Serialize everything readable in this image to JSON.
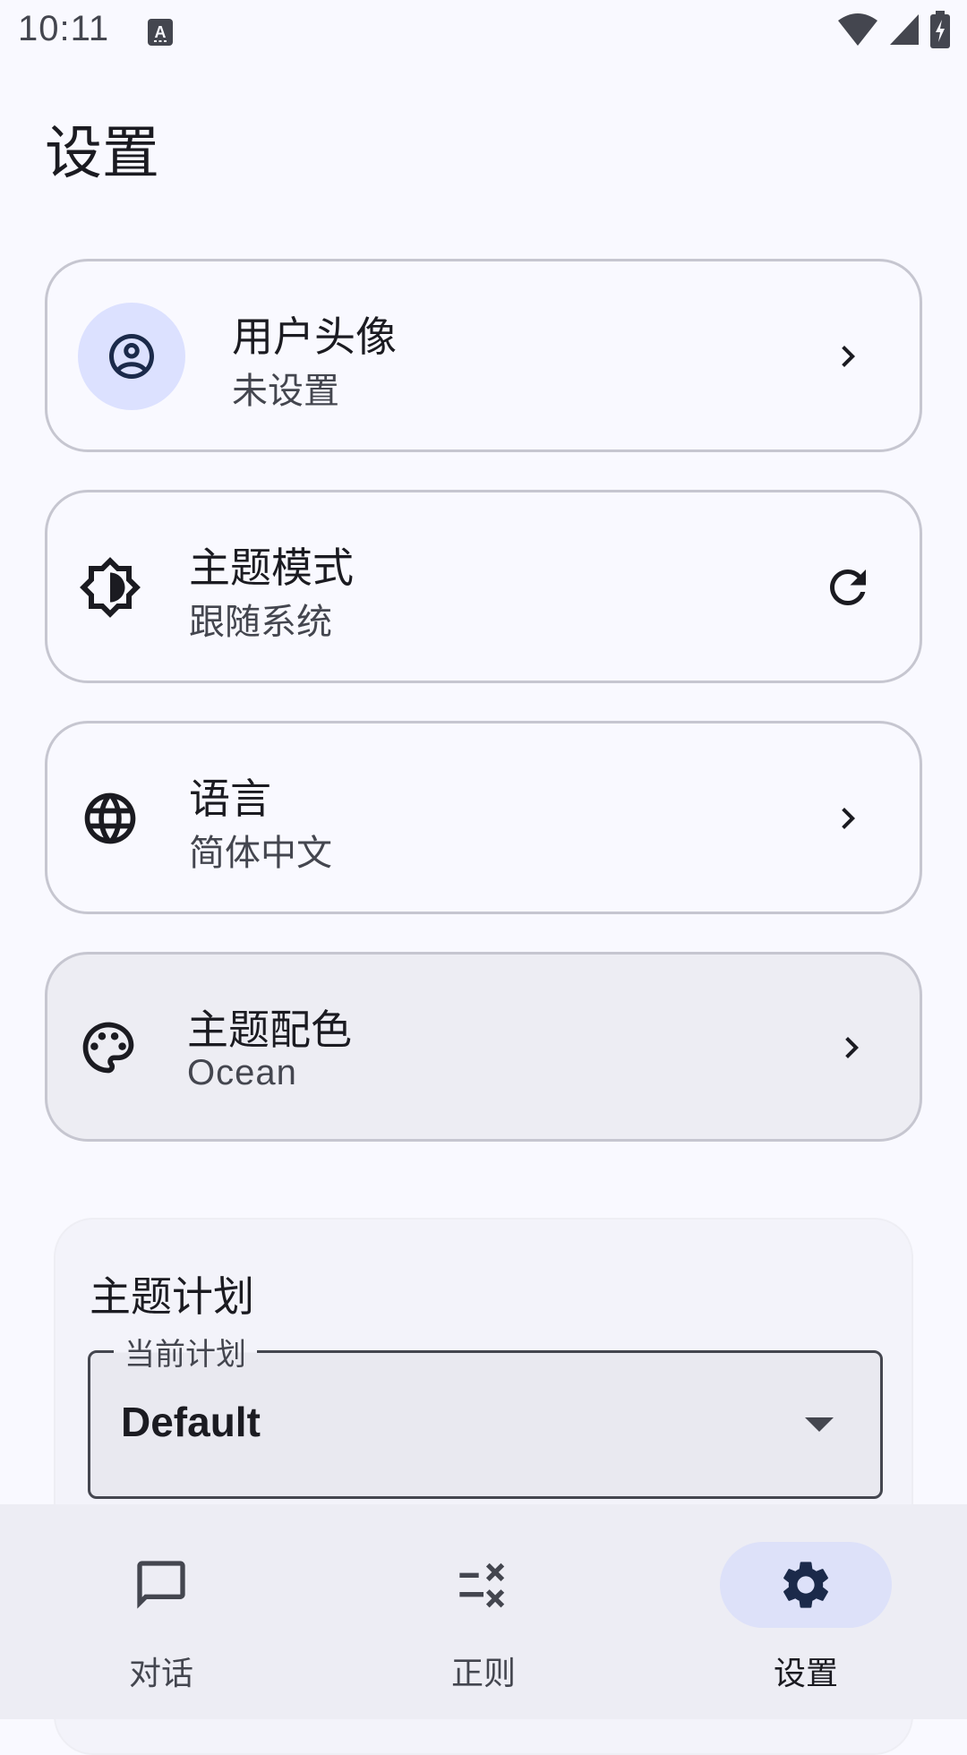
{
  "status_bar": {
    "time": "10:11",
    "icons": [
      "text-input-icon",
      "wifi-icon",
      "cell-signal-icon",
      "battery-charging-icon"
    ]
  },
  "page": {
    "title": "设置"
  },
  "settings": {
    "items": [
      {
        "title": "用户头像",
        "subtitle": "未设置",
        "icon": "account-circle-icon",
        "trailing": "chevron-right-icon"
      },
      {
        "title": "主题模式",
        "subtitle": "跟随系统",
        "icon": "brightness-auto-icon",
        "trailing": "refresh-icon"
      },
      {
        "title": "语言",
        "subtitle": "简体中文",
        "icon": "globe-icon",
        "trailing": "chevron-right-icon"
      },
      {
        "title": "主题配色",
        "subtitle": "Ocean",
        "icon": "palette-icon",
        "trailing": "chevron-right-icon"
      }
    ]
  },
  "theme_plan": {
    "title": "主题计划",
    "field_label": "当前计划",
    "selected": "Default"
  },
  "bottom_nav": {
    "items": [
      {
        "label": "对话",
        "icon": "chat-bubble-icon",
        "active": false
      },
      {
        "label": "正则",
        "icon": "rule-icon",
        "active": false
      },
      {
        "label": "设置",
        "icon": "gear-icon",
        "active": true
      }
    ]
  },
  "colors": {
    "background": "#f9f9ff",
    "card_border": "#c6c6d0",
    "avatar_bg": "#dce1ff",
    "nav_indicator": "#dde1f9",
    "icon_dark": "#1b2a4a",
    "text_secondary": "#44464f"
  }
}
